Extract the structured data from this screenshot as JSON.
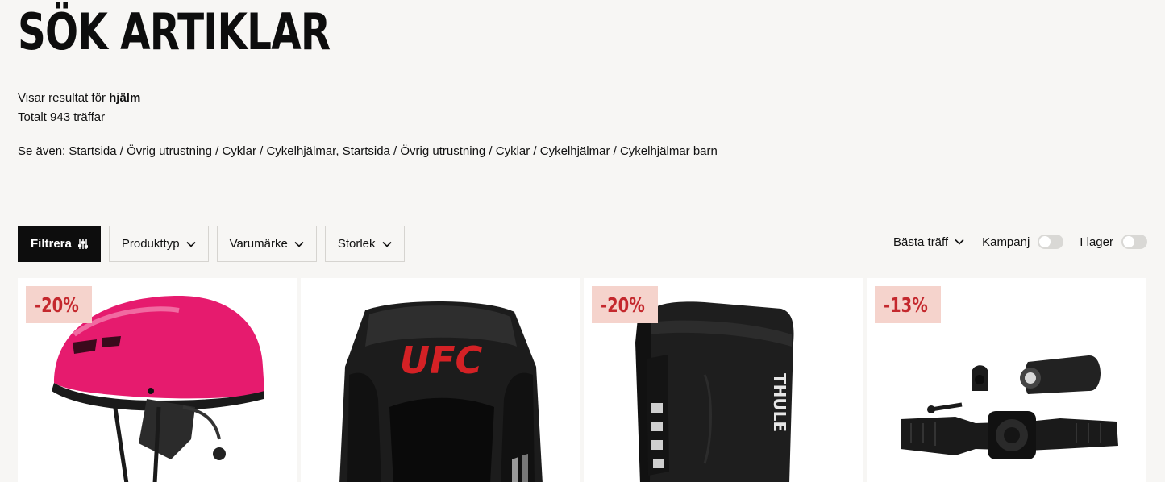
{
  "page": {
    "title": "SÖK ARTIKLAR",
    "results_prefix": "Visar resultat för",
    "query": "hjälm",
    "total": "Totalt 943 träffar",
    "see_also_label": "Se även:",
    "see_also_links": [
      "Startsida / Övrig utrustning / Cyklar / Cykelhjälmar",
      "Startsida / Övrig utrustning / Cyklar / Cykelhjälmar / Cykelhjälmar barn"
    ],
    "see_also_separator": ","
  },
  "filters": {
    "filter_button": "Filtrera",
    "dropdowns": [
      "Produkttyp",
      "Varumärke",
      "Storlek"
    ]
  },
  "controls": {
    "sort": "Bästa träff",
    "toggles": [
      {
        "label": "Kampanj",
        "on": false
      },
      {
        "label": "I lager",
        "on": false
      }
    ]
  },
  "products": [
    {
      "badge": "-20%",
      "icon": "pink-bike-helmet-image"
    },
    {
      "badge": "",
      "icon": "ufc-boxing-headgear-image",
      "logo_text": "UFC"
    },
    {
      "badge": "-20%",
      "icon": "thule-pannier-bag-image",
      "logo_text": "THULE"
    },
    {
      "badge": "-13%",
      "icon": "bike-light-mount-kit-image"
    }
  ],
  "colors": {
    "background": "#f7f6f4",
    "badge_bg": "#f5d3cc",
    "badge_text": "#c4282d",
    "primary_button": "#0d0d0d",
    "helmet_pink": "#e61b6e"
  }
}
